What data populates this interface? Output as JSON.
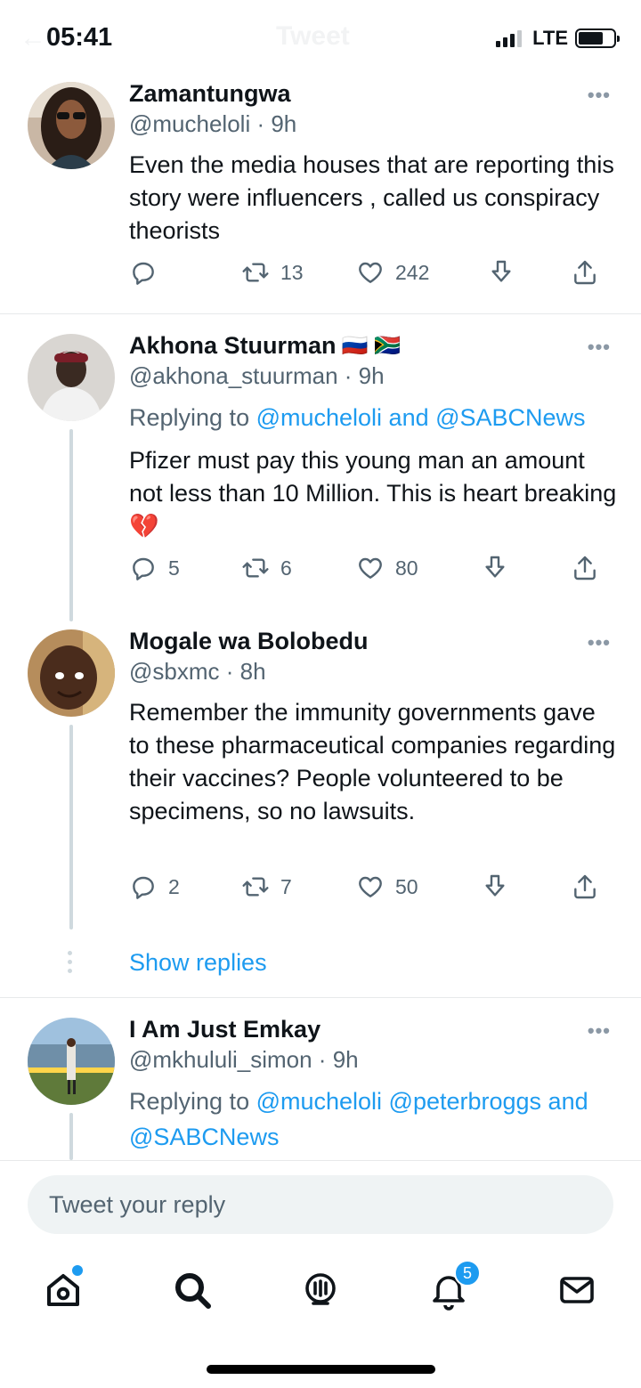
{
  "status_bar": {
    "time": "05:41",
    "network": "LTE",
    "ghost_title": "Tweet",
    "ghost_back": "←"
  },
  "tweets": [
    {
      "name": "Zamantungwa",
      "handle": "@mucheloli",
      "time": "9h",
      "text": "Even the media houses that are reporting this story were influencers , called us conspiracy theorists",
      "reply_count": "",
      "retweet_count": "13",
      "like_count": "242"
    },
    {
      "name": "Akhona Stuurman",
      "flags": "🇷🇺 🇿🇦",
      "handle": "@akhona_stuurman",
      "time": "9h",
      "replying_prefix": "Replying to ",
      "replying_to": "@mucheloli and @SABCNews",
      "text": "Pfizer must pay this young man an amount not less than 10 Million. This is heart breaking 💔",
      "reply_count": "5",
      "retweet_count": "6",
      "like_count": "80"
    },
    {
      "name": "Mogale wa Bolobedu",
      "handle": "@sbxmc",
      "time": "8h",
      "text": "Remember the immunity governments gave to these pharmaceutical companies regarding their vaccines? People volunteered to be specimens, so no lawsuits.",
      "reply_count": "2",
      "retweet_count": "7",
      "like_count": "50"
    },
    {
      "name": "I Am Just Emkay",
      "handle": "@mkhululi_simon",
      "time": "9h",
      "replying_prefix": "Replying to ",
      "replying_to": "@mucheloli @peterbroggs and @SABCNews"
    }
  ],
  "show_replies": "Show replies",
  "reply_box": {
    "placeholder": "Tweet your reply"
  },
  "tab_bar": {
    "notifications_badge": "5"
  },
  "icons": {
    "reply": "reply-icon",
    "retweet": "retweet-icon",
    "like": "heart-icon",
    "bookmark": "bookmark-download-icon",
    "share": "share-icon",
    "home": "home-icon",
    "search": "search-icon",
    "spaces": "spaces-icon",
    "notifications": "bell-icon",
    "messages": "mail-icon"
  },
  "colors": {
    "accent": "#1d9bf0",
    "secondary_text": "#536471",
    "divider": "#e7e9ea"
  }
}
